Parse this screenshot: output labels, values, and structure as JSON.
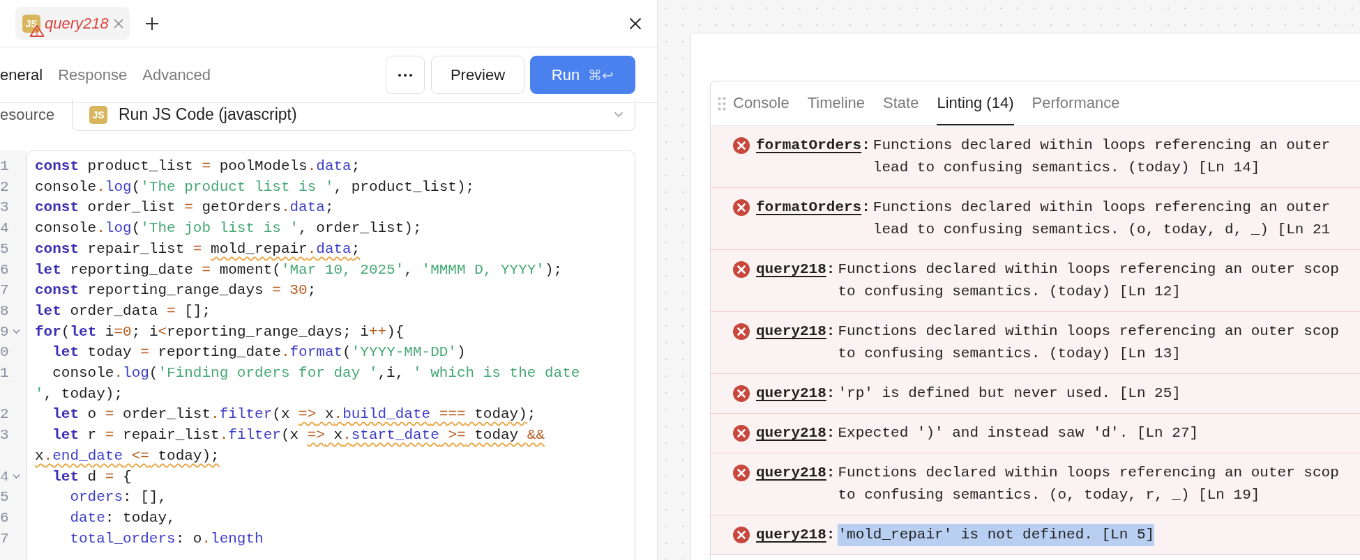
{
  "editor_tab": {
    "badge": "JS",
    "title": "query218",
    "has_error": true
  },
  "editor_tabs": [
    {
      "label": "eneral",
      "selected": true
    },
    {
      "label": "Response",
      "selected": false
    },
    {
      "label": "Advanced",
      "selected": false
    }
  ],
  "buttons": {
    "preview": "Preview",
    "run": "Run",
    "run_shortcut": "⌘↩"
  },
  "resource": {
    "label": "esource",
    "badge": "JS",
    "value": "Run JS Code (javascript)"
  },
  "code": [
    {
      "number": "1",
      "fold": false,
      "tokens": [
        {
          "kind": "keyword",
          "text": "const"
        },
        {
          "kind": "plain",
          "text": " product_list "
        },
        {
          "kind": "operator",
          "text": "="
        },
        {
          "kind": "plain",
          "text": " poolModels"
        },
        {
          "kind": "operator",
          "text": "."
        },
        {
          "kind": "property",
          "text": "data"
        },
        {
          "kind": "plain",
          "text": ";"
        }
      ]
    },
    {
      "number": "2",
      "fold": false,
      "tokens": [
        {
          "kind": "plain",
          "text": "console"
        },
        {
          "kind": "operator",
          "text": "."
        },
        {
          "kind": "property",
          "text": "log"
        },
        {
          "kind": "plain",
          "text": "("
        },
        {
          "kind": "string",
          "text": "'The product list is '"
        },
        {
          "kind": "plain",
          "text": ", product_list);"
        }
      ]
    },
    {
      "number": "3",
      "fold": false,
      "tokens": [
        {
          "kind": "keyword",
          "text": "const"
        },
        {
          "kind": "plain",
          "text": " order_list "
        },
        {
          "kind": "operator",
          "text": "="
        },
        {
          "kind": "plain",
          "text": " getOrders"
        },
        {
          "kind": "operator",
          "text": "."
        },
        {
          "kind": "property",
          "text": "data"
        },
        {
          "kind": "plain",
          "text": ";"
        }
      ]
    },
    {
      "number": "4",
      "fold": false,
      "tokens": [
        {
          "kind": "plain",
          "text": "console"
        },
        {
          "kind": "operator",
          "text": "."
        },
        {
          "kind": "property",
          "text": "log"
        },
        {
          "kind": "plain",
          "text": "("
        },
        {
          "kind": "string",
          "text": "'The job list is '"
        },
        {
          "kind": "plain",
          "text": ", order_list);"
        }
      ]
    },
    {
      "number": "5",
      "fold": false,
      "tokens": [
        {
          "kind": "keyword",
          "text": "const"
        },
        {
          "kind": "plain",
          "text": " repair_list "
        },
        {
          "kind": "operator",
          "text": "= "
        },
        {
          "kind": "flagged",
          "tokens": [
            {
              "kind": "plain",
              "text": "mold_repair"
            },
            {
              "kind": "operator",
              "text": "."
            },
            {
              "kind": "property",
              "text": "data"
            },
            {
              "kind": "plain",
              "text": ";"
            }
          ]
        }
      ]
    },
    {
      "number": "6",
      "fold": false,
      "tokens": [
        {
          "kind": "keyword",
          "text": "let"
        },
        {
          "kind": "plain",
          "text": " reporting_date "
        },
        {
          "kind": "operator",
          "text": "="
        },
        {
          "kind": "plain",
          "text": " moment("
        },
        {
          "kind": "string",
          "text": "'Mar 10, 2025'"
        },
        {
          "kind": "plain",
          "text": ", "
        },
        {
          "kind": "string",
          "text": "'MMMM D, YYYY'"
        },
        {
          "kind": "plain",
          "text": ");"
        }
      ]
    },
    {
      "number": "7",
      "fold": false,
      "tokens": [
        {
          "kind": "keyword",
          "text": "const"
        },
        {
          "kind": "plain",
          "text": " reporting_range_days "
        },
        {
          "kind": "operator",
          "text": "= "
        },
        {
          "kind": "number",
          "text": "30"
        },
        {
          "kind": "plain",
          "text": ";"
        }
      ]
    },
    {
      "number": "8",
      "fold": false,
      "tokens": [
        {
          "kind": "keyword",
          "text": "let"
        },
        {
          "kind": "plain",
          "text": " order_data "
        },
        {
          "kind": "operator",
          "text": "="
        },
        {
          "kind": "plain",
          "text": " [];"
        }
      ]
    },
    {
      "number": "9",
      "fold": true,
      "tokens": [
        {
          "kind": "keyword",
          "text": "for"
        },
        {
          "kind": "plain",
          "text": "("
        },
        {
          "kind": "keyword",
          "text": "let"
        },
        {
          "kind": "plain",
          "text": " i"
        },
        {
          "kind": "operator",
          "text": "="
        },
        {
          "kind": "number",
          "text": "0"
        },
        {
          "kind": "plain",
          "text": "; i"
        },
        {
          "kind": "operator",
          "text": "<"
        },
        {
          "kind": "plain",
          "text": "reporting_range_days; i"
        },
        {
          "kind": "operator",
          "text": "++"
        },
        {
          "kind": "plain",
          "text": "){"
        }
      ]
    },
    {
      "number": "0",
      "fold": false,
      "tokens": [
        {
          "kind": "keyword",
          "text": "  let"
        },
        {
          "kind": "plain",
          "text": " today "
        },
        {
          "kind": "operator",
          "text": "="
        },
        {
          "kind": "plain",
          "text": " reporting_date"
        },
        {
          "kind": "operator",
          "text": "."
        },
        {
          "kind": "property",
          "text": "format"
        },
        {
          "kind": "plain",
          "text": "("
        },
        {
          "kind": "string",
          "text": "'YYYY-MM-DD'"
        },
        {
          "kind": "plain",
          "text": ")"
        }
      ]
    },
    {
      "number": "1",
      "fold": false,
      "tokens": [
        {
          "kind": "plain",
          "text": "  console"
        },
        {
          "kind": "operator",
          "text": "."
        },
        {
          "kind": "property",
          "text": "log"
        },
        {
          "kind": "plain",
          "text": "("
        },
        {
          "kind": "string",
          "text": "'Finding orders for day '"
        },
        {
          "kind": "plain",
          "text": ",i, "
        },
        {
          "kind": "string",
          "text": "' which is the date"
        },
        {
          "kind": "break"
        },
        {
          "kind": "string",
          "text": "'"
        },
        {
          "kind": "plain",
          "text": ", today);"
        }
      ]
    },
    {
      "number": "2",
      "fold": false,
      "tokens": [
        {
          "kind": "keyword",
          "text": "  let"
        },
        {
          "kind": "plain",
          "text": " o "
        },
        {
          "kind": "operator",
          "text": "="
        },
        {
          "kind": "plain",
          "text": " order_list"
        },
        {
          "kind": "operator",
          "text": "."
        },
        {
          "kind": "property",
          "text": "filter"
        },
        {
          "kind": "plain",
          "text": "(x "
        },
        {
          "kind": "flagged",
          "tokens": [
            {
              "kind": "operator",
              "text": "=>"
            },
            {
              "kind": "plain",
              "text": " x"
            },
            {
              "kind": "operator",
              "text": "."
            },
            {
              "kind": "property",
              "text": "build_date"
            },
            {
              "kind": "operator",
              "text": " ==="
            },
            {
              "kind": "plain",
              "text": " today)"
            }
          ]
        },
        {
          "kind": "plain",
          "text": ";"
        }
      ]
    },
    {
      "number": "3",
      "fold": false,
      "tokens": [
        {
          "kind": "keyword",
          "text": "  let"
        },
        {
          "kind": "plain",
          "text": " r "
        },
        {
          "kind": "operator",
          "text": "="
        },
        {
          "kind": "plain",
          "text": " repair_list"
        },
        {
          "kind": "operator",
          "text": "."
        },
        {
          "kind": "property",
          "text": "filter"
        },
        {
          "kind": "plain",
          "text": "(x "
        },
        {
          "kind": "flagged",
          "tokens": [
            {
              "kind": "operator",
              "text": "=>"
            },
            {
              "kind": "plain",
              "text": " x"
            },
            {
              "kind": "operator",
              "text": "."
            },
            {
              "kind": "property",
              "text": "start_date"
            },
            {
              "kind": "operator",
              "text": " >="
            },
            {
              "kind": "plain",
              "text": " today "
            },
            {
              "kind": "operator",
              "text": "&&"
            }
          ]
        },
        {
          "kind": "break"
        },
        {
          "kind": "flagged",
          "tokens": [
            {
              "kind": "plain",
              "text": "x"
            },
            {
              "kind": "operator",
              "text": "."
            },
            {
              "kind": "property",
              "text": "end_date"
            },
            {
              "kind": "operator",
              "text": " <="
            },
            {
              "kind": "plain",
              "text": " today);"
            }
          ]
        }
      ]
    },
    {
      "number": "4",
      "fold": true,
      "tokens": [
        {
          "kind": "keyword",
          "text": "  let"
        },
        {
          "kind": "plain",
          "text": " d "
        },
        {
          "kind": "operator",
          "text": "="
        },
        {
          "kind": "plain",
          "text": " {"
        }
      ]
    },
    {
      "number": "5",
      "fold": false,
      "tokens": [
        {
          "kind": "property",
          "text": "    orders"
        },
        {
          "kind": "plain",
          "text": ": [],"
        }
      ]
    },
    {
      "number": "6",
      "fold": false,
      "tokens": [
        {
          "kind": "property",
          "text": "    date"
        },
        {
          "kind": "plain",
          "text": ": today,"
        }
      ]
    },
    {
      "number": "7",
      "fold": false,
      "tokens": [
        {
          "kind": "property",
          "text": "    total_orders"
        },
        {
          "kind": "plain",
          "text": ": o"
        },
        {
          "kind": "operator",
          "text": "."
        },
        {
          "kind": "property",
          "text": "length"
        }
      ]
    }
  ],
  "debug_panel": {
    "tabs": [
      {
        "label": "Console",
        "selected": false
      },
      {
        "label": "Timeline",
        "selected": false
      },
      {
        "label": "State",
        "selected": false
      },
      {
        "label": "Linting (14)",
        "selected": true
      },
      {
        "label": "Performance",
        "selected": false
      }
    ],
    "lint": [
      {
        "source": "formatOrders",
        "punct": ":",
        "message": "Functions declared within loops referencing an outer\nlead to confusing semantics. (today) [Ln 14]",
        "highlighted": false
      },
      {
        "source": "formatOrders",
        "punct": ":",
        "message": "Functions declared within loops referencing an outer\nlead to confusing semantics. (o, today, d, _) [Ln 21",
        "highlighted": false
      },
      {
        "source": "query218",
        "punct": ":",
        "message": "Functions declared within loops referencing an outer scop\nto confusing semantics. (today) [Ln 12]",
        "highlighted": false
      },
      {
        "source": "query218",
        "punct": ":",
        "message": "Functions declared within loops referencing an outer scop\nto confusing semantics. (today) [Ln 13]",
        "highlighted": false
      },
      {
        "source": "query218",
        "punct": ":",
        "message": "'rp' is defined but never used. [Ln 25]",
        "highlighted": false
      },
      {
        "source": "query218",
        "punct": ":",
        "message": "Expected ')' and instead saw 'd'. [Ln 27]",
        "highlighted": false
      },
      {
        "source": "query218",
        "punct": ":",
        "message": "Functions declared within loops referencing an outer scop\nto confusing semantics. (o, today, r, _) [Ln 19]",
        "highlighted": false
      },
      {
        "source": "query218",
        "punct": ":",
        "message": "'mold_repair' is not defined. [Ln 5]",
        "highlighted": true
      }
    ]
  }
}
